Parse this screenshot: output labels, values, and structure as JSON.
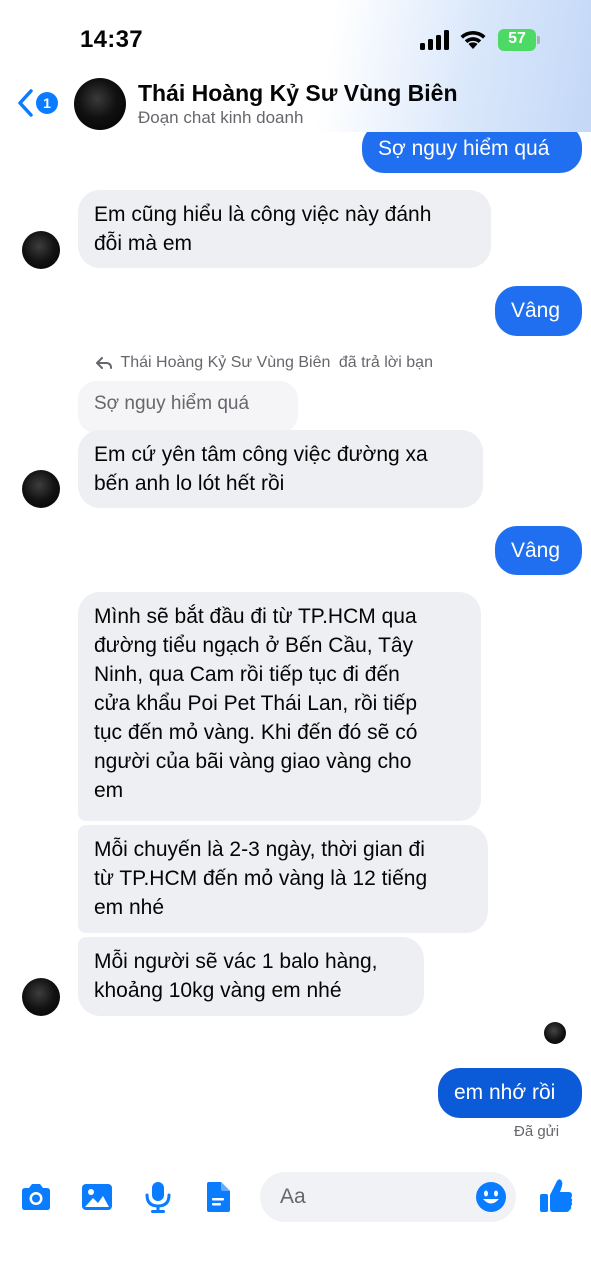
{
  "status_bar": {
    "time": "14:37",
    "battery": "57"
  },
  "header": {
    "back_badge": "1",
    "name": "Thái Hoàng Kỷ Sư Vùng Biên",
    "subtitle": "Đoạn chat kinh doanh"
  },
  "messages": [
    {
      "side": "out",
      "text": "Sợ nguy hiểm quá"
    },
    {
      "side": "in",
      "lines": [
        "Em cũng hiểu là công việc này đánh",
        "đỗi mà em"
      ]
    },
    {
      "side": "out",
      "text": "Vâng"
    },
    {
      "side": "in",
      "reply_to": {
        "author": "Thái Hoàng Kỷ Sư Vùng Biên",
        "action": "đã trả lời bạn",
        "quoted": "Sợ nguy hiểm quá"
      },
      "lines": [
        "Em cứ yên tâm công việc đường xa",
        "bến anh lo lót hết rồi"
      ]
    },
    {
      "side": "out",
      "text": "Vâng"
    },
    {
      "side": "in",
      "lines": [
        "Mình sẽ bắt đầu đi từ TP.HCM qua",
        "đường tiểu ngạch ở Bến Cầu, Tây",
        "Ninh, qua Cam rồi tiếp tục đi đến",
        "cửa khẩu Poi Pet Thái Lan, rồi tiếp",
        "tục đến mỏ vàng. Khi đến đó sẽ có",
        "người của bãi vàng giao vàng cho",
        "em"
      ]
    },
    {
      "side": "in",
      "lines": [
        "Mỗi chuyến là 2-3 ngày, thời gian đi",
        "từ TP.HCM đến mỏ vàng là 12 tiếng",
        "em nhé"
      ]
    },
    {
      "side": "in",
      "lines": [
        "Mỗi người sẽ vác 1 balo hàng,",
        "khoảng 10kg vàng em nhé"
      ]
    },
    {
      "side": "out",
      "text": "em nhớ rồi",
      "status": "Đã gửi"
    }
  ],
  "composer": {
    "placeholder": "Aa"
  },
  "colors": {
    "accent": "#0a7cff",
    "outgoing_bubble": "#1f6ff0",
    "incoming_bubble": "#eeeff2",
    "battery": "#4cd964"
  },
  "icons": [
    "camera-icon",
    "gallery-icon",
    "microphone-icon",
    "file-icon",
    "emoji-icon",
    "like-icon"
  ]
}
